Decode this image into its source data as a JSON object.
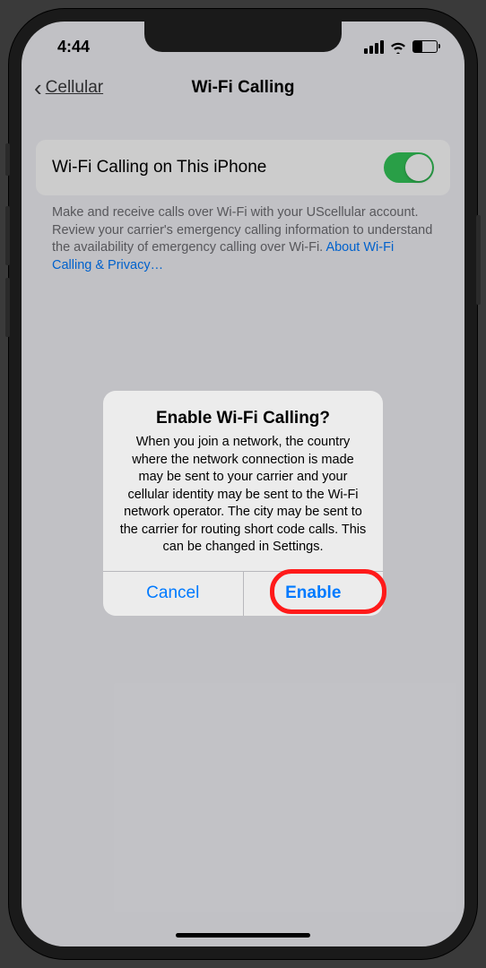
{
  "status": {
    "time": "4:44"
  },
  "nav": {
    "back_label": "Cellular",
    "title": "Wi-Fi Calling"
  },
  "setting": {
    "label": "Wi-Fi Calling on This iPhone",
    "toggle_on": true
  },
  "footer": {
    "text": "Make and receive calls over Wi-Fi with your UScellular account. Review your carrier's emergency calling information to understand the availability of emergency calling over Wi-Fi. ",
    "link": "About Wi-Fi Calling & Privacy…"
  },
  "alert": {
    "title": "Enable Wi-Fi Calling?",
    "message": "When you join a network, the country where the network connection is made may be sent to your carrier and your cellular identity may be sent to the Wi-Fi network operator. The city may be sent to the carrier for routing short code calls. This can be changed in Settings.",
    "cancel": "Cancel",
    "confirm": "Enable"
  }
}
